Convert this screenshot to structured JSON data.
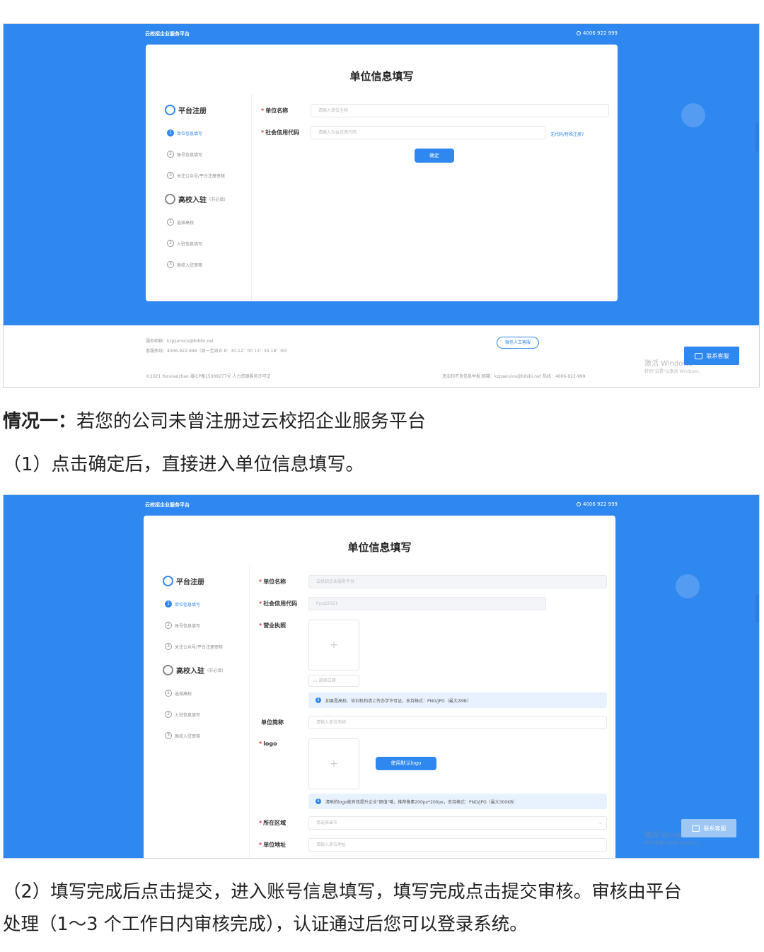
{
  "screenshot1": {
    "brand": "云校招企业服务平台",
    "phone": "4006 922 999",
    "card_title": "单位信息填写",
    "steps": {
      "group1": "平台注册",
      "group1_sub": [
        "单位信息填写",
        "账号信息填写",
        "关注公众号/平台注册审核"
      ],
      "group2": "高校入驻",
      "group2_note": "(非必填)",
      "group2_sub": [
        "选择高校",
        "入驻信息填写",
        "高校入驻审核"
      ]
    },
    "form": {
      "name_label": "单位名称",
      "name_placeholder": "请输入单位全称",
      "code_label": "社会信用代码",
      "code_placeholder": "请输入社会信用代码",
      "code_link": "无代码/特殊注册?",
      "confirm": "确定"
    },
    "footer": {
      "email": "服务邮箱：kzpservice@bibibi.net",
      "hotline": "客服热线：4006-922-999（周一至周五 8：30-12：00 13：30-18：00）",
      "wechat_btn": "微信人工客服",
      "copyright": "©2021 Yunxiaozhao 湘ICP备15008277号  人力资源服务许可证",
      "report": "违法和不良信息举报 邮箱：kzpservice@bibibi.net 热线：4006-922-999",
      "contact": "联系客服",
      "watermark": "激活 Windows",
      "watermark_sub": "转到\"设置\"以激活 Windows。"
    }
  },
  "para1": {
    "bold": "情况一：",
    "text": "若您的公司未曾注册过云校招企业服务平台"
  },
  "para2": "（1）点击确定后，直接进入单位信息填写。",
  "screenshot2": {
    "brand": "云校招企业服务平台",
    "phone": "4006 922 999",
    "card_title": "单位信息填写",
    "steps": {
      "group1": "平台注册",
      "group1_sub": [
        "单位信息填写",
        "账号信息填写",
        "关注公众号/平台注册审核"
      ],
      "group2": "高校入驻",
      "group2_note": "(非必填)",
      "group2_sub": [
        "选择高校",
        "入驻信息填写",
        "高校入驻审核"
      ]
    },
    "form": {
      "name_label": "单位名称",
      "name_value": "云校招企业服务平台",
      "code_label": "社会信用代码",
      "code_value": "llyxjz2021",
      "license_label": "营业执照",
      "date_placeholder": "选择日期",
      "license_info": "如果是高校、培训机构请上传办学许可证。支持格式：PNG/JPG（最大2MB）",
      "short_label": "单位简称",
      "short_placeholder": "请输入单位简称",
      "logo_label": "logo",
      "logo_btn": "使用默认logo",
      "logo_info": "清晰的logo能有效提升企业\"颜值\"哦，推荐像素200px*200px，支持格式：PNG/JPG（最大300KB）",
      "region_label": "所在区域",
      "region_placeholder": "请选择省市",
      "address_label": "单位地址",
      "address_placeholder": "请输入单位地址",
      "plus": "+"
    },
    "contact": "联系客服",
    "watermark": "激活 Windows",
    "watermark_sub": "转到\"设置\"以激活 Windows。"
  },
  "para3_line1": "（2）填写完成后点击提交，进入账号信息填写，填写完成点击提交审核。审核由平台",
  "para3_line2": "处理（1～3 个工作日内审核完成），认证通过后您可以登录系统。"
}
